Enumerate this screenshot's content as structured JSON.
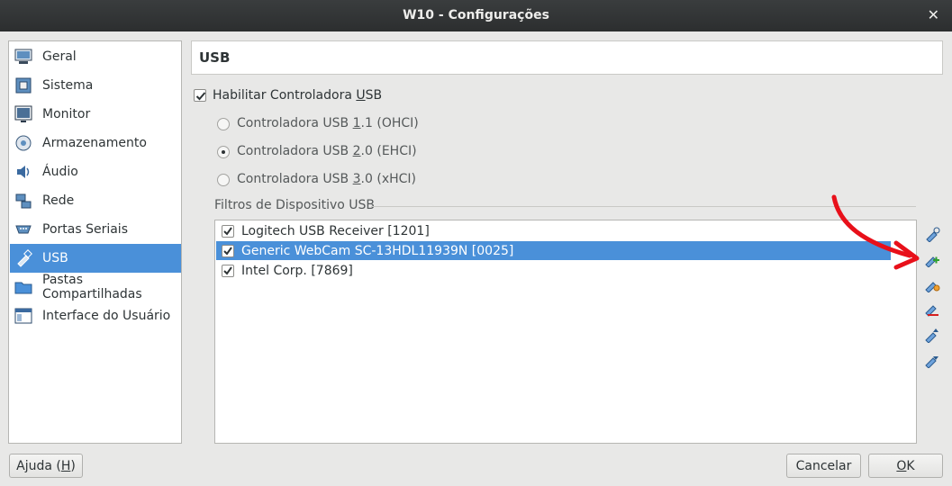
{
  "window": {
    "title": "W10 - Configurações",
    "close_glyph": "✕"
  },
  "sidebar": {
    "items": [
      {
        "label": "Geral",
        "icon": "monitor-general-icon"
      },
      {
        "label": "Sistema",
        "icon": "chip-icon"
      },
      {
        "label": "Monitor",
        "icon": "display-icon"
      },
      {
        "label": "Armazenamento",
        "icon": "disk-icon"
      },
      {
        "label": "Áudio",
        "icon": "speaker-icon"
      },
      {
        "label": "Rede",
        "icon": "network-icon"
      },
      {
        "label": "Portas Seriais",
        "icon": "serial-port-icon"
      },
      {
        "label": "USB",
        "icon": "usb-icon",
        "selected": true
      },
      {
        "label": "Pastas Compartilhadas",
        "icon": "folder-icon"
      },
      {
        "label": "Interface do Usuário",
        "icon": "window-icon"
      }
    ]
  },
  "page": {
    "title": "USB"
  },
  "usb": {
    "enable_pre": "Habilitar Controladora ",
    "enable_key": "U",
    "enable_post": "SB",
    "enable_checked": true,
    "controllers": [
      {
        "pre": "Controladora USB ",
        "key": "1",
        "post": ".1 (OHCI)",
        "selected": false
      },
      {
        "pre": "Controladora USB ",
        "key": "2",
        "post": ".0 (EHCI)",
        "selected": true
      },
      {
        "pre": "Controladora USB ",
        "key": "3",
        "post": ".0 (xHCI)",
        "selected": false
      }
    ],
    "filters_label": "Filtros de Dispositivo USB",
    "filters": [
      {
        "label": "Logitech USB Receiver [1201]",
        "checked": true,
        "selected": false
      },
      {
        "label": "Generic WebCam SC-13HDL11939N [0025]",
        "checked": true,
        "selected": true
      },
      {
        "label": "Intel Corp.  [7869]",
        "checked": true,
        "selected": false
      }
    ],
    "tools": [
      "add-empty-filter-icon",
      "add-filter-from-device-icon",
      "edit-filter-icon",
      "remove-filter-icon",
      "move-filter-up-icon",
      "move-filter-down-icon"
    ]
  },
  "buttons": {
    "help_pre": "Ajuda (",
    "help_key": "H",
    "help_post": ")",
    "cancel": "Cancelar",
    "ok_key": "O",
    "ok_post": "K"
  },
  "colors": {
    "selection": "#4a90d9",
    "annotation_arrow": "#e8101a"
  }
}
